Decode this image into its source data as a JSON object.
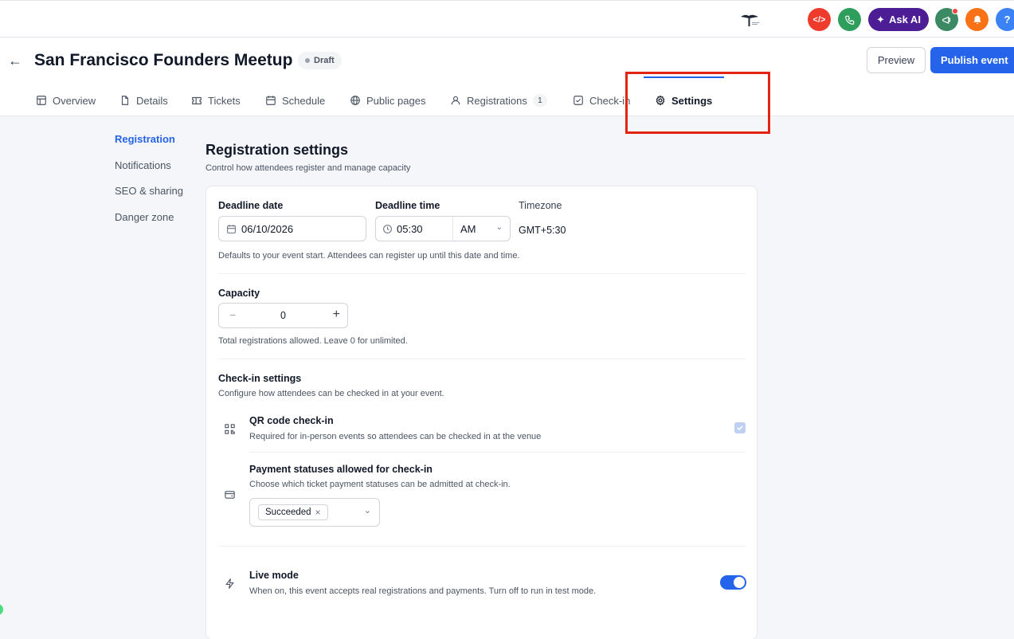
{
  "topbar": {
    "ask_ai_label": "Ask AI",
    "colors": {
      "code": "#ef3b2c",
      "phone": "#2f9e5d",
      "ask_ai": "#4c1d95",
      "announce": "#3b8a63",
      "bell": "#f97316",
      "help": "#3b82f6"
    }
  },
  "header": {
    "title": "San Francisco Founders Meetup",
    "status_badge": "Draft",
    "preview_label": "Preview",
    "publish_label": "Publish event"
  },
  "tabs": [
    {
      "label": "Overview",
      "icon": "layout-icon"
    },
    {
      "label": "Details",
      "icon": "file-icon"
    },
    {
      "label": "Tickets",
      "icon": "ticket-icon"
    },
    {
      "label": "Schedule",
      "icon": "calendar-icon"
    },
    {
      "label": "Public pages",
      "icon": "globe-icon"
    },
    {
      "label": "Registrations",
      "icon": "users-icon",
      "count": "1"
    },
    {
      "label": "Check-in",
      "icon": "check-square-icon"
    },
    {
      "label": "Settings",
      "icon": "gear-icon",
      "active": true
    }
  ],
  "subnav": [
    {
      "label": "Registration",
      "active": true
    },
    {
      "label": "Notifications"
    },
    {
      "label": "SEO & sharing"
    },
    {
      "label": "Danger zone"
    }
  ],
  "main": {
    "title": "Registration settings",
    "subtitle": "Control how attendees register and manage capacity",
    "deadline": {
      "date_label": "Deadline date",
      "date_value": "06/10/2026",
      "time_label": "Deadline time",
      "time_value": "05:30",
      "ampm_value": "AM",
      "timezone_label": "Timezone",
      "timezone_value": "GMT+5:30",
      "help": "Defaults to your event start. Attendees can register up until this date and time."
    },
    "capacity": {
      "label": "Capacity",
      "value": "0",
      "minus": "−",
      "plus": "+",
      "help": "Total registrations allowed. Leave 0 for unlimited."
    },
    "checkin": {
      "title": "Check-in settings",
      "subtitle": "Configure how attendees can be checked in at your event.",
      "qr_title": "QR code check-in",
      "qr_desc": "Required for in-person events so attendees can be checked in at the venue",
      "qr_checked": true,
      "payment_title": "Payment statuses allowed for check-in",
      "payment_desc": "Choose which ticket payment statuses can be admitted at check-in.",
      "payment_selected": "Succeeded",
      "chip_remove": "×"
    },
    "live_mode": {
      "title": "Live mode",
      "desc": "When on, this event accepts real registrations and payments. Turn off to run in test mode.",
      "enabled": true
    }
  }
}
